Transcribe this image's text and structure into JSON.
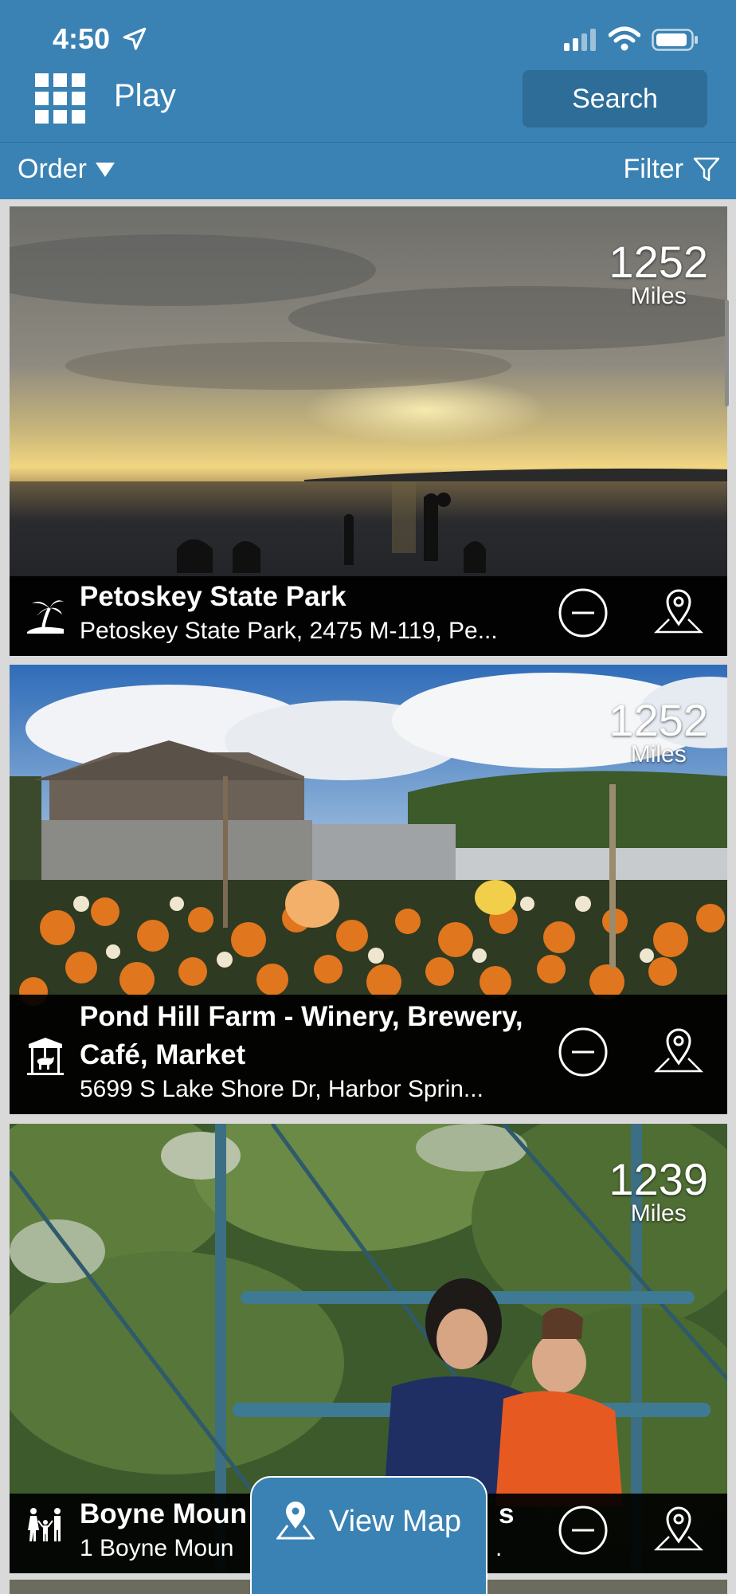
{
  "status_bar": {
    "time": "4:50"
  },
  "header": {
    "title": "Play",
    "search_label": "Search"
  },
  "toolbar": {
    "order_label": "Order",
    "filter_label": "Filter"
  },
  "places": [
    {
      "name": "Petoskey State Park",
      "address": "Petoskey State Park, 2475 M-119, Pe...",
      "distance": "1252",
      "unit": "Miles",
      "category_icon": "beach-palm-icon"
    },
    {
      "name": "Pond Hill Farm - Winery, Brewery, Café, Market",
      "address": "5699 S Lake Shore Dr, Harbor Sprin...",
      "distance": "1252",
      "unit": "Miles",
      "category_icon": "carousel-icon"
    },
    {
      "name": "Boyne Moun",
      "name_tail": "s",
      "address": "1 Boyne Moun",
      "address_tail": ".",
      "distance": "1239",
      "unit": "Miles",
      "category_icon": "family-icon"
    }
  ],
  "view_map_label": "View Map",
  "colors": {
    "header": "#3a82b3",
    "search_button": "#2d6d98",
    "card_shade": "#000000"
  }
}
